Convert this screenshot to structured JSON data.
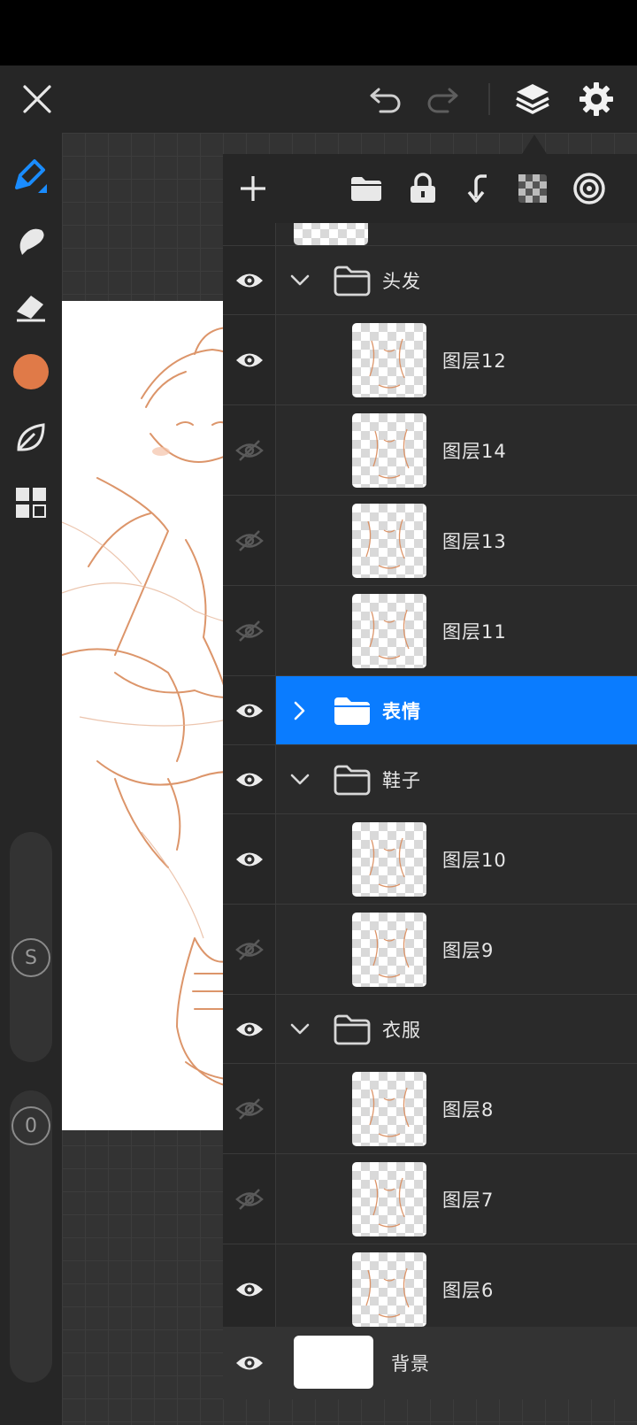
{
  "colors": {
    "accent": "#0a7cff",
    "brush_color": "#e07a48",
    "panel_bg": "#262626"
  },
  "top_bar": {
    "close": {
      "icon": "close-icon"
    },
    "undo": {
      "icon": "undo-icon"
    },
    "redo": {
      "icon": "redo-icon"
    },
    "layers": {
      "icon": "layers-icon"
    },
    "settings": {
      "icon": "gear-icon"
    }
  },
  "left_toolbar": {
    "tools": [
      {
        "name": "brush",
        "icon": "brush-icon",
        "active": true
      },
      {
        "name": "smudge",
        "icon": "smudge-icon",
        "active": false
      },
      {
        "name": "eraser",
        "icon": "eraser-icon",
        "active": false
      },
      {
        "name": "color",
        "icon": "color-swatch-icon",
        "active": false
      },
      {
        "name": "brush-library",
        "icon": "leaf-icon",
        "active": false
      },
      {
        "name": "gallery",
        "icon": "grid-icon",
        "active": false
      }
    ],
    "size_slider": {
      "label": "S"
    },
    "opacity_slider": {
      "label": "0"
    }
  },
  "layers_panel": {
    "toolbar": [
      {
        "icon": "plus-icon"
      },
      {
        "icon": "folder-icon"
      },
      {
        "icon": "lock-icon"
      },
      {
        "icon": "merge-down-icon"
      },
      {
        "icon": "alpha-lock-icon"
      },
      {
        "icon": "blend-mode-icon"
      }
    ],
    "rows": [
      {
        "type": "folder",
        "label": "头发",
        "visible": true,
        "expanded": true
      },
      {
        "type": "layer",
        "label": "图层12",
        "visible": true
      },
      {
        "type": "layer",
        "label": "图层14",
        "visible": false
      },
      {
        "type": "layer",
        "label": "图层13",
        "visible": false
      },
      {
        "type": "layer",
        "label": "图层11",
        "visible": false
      },
      {
        "type": "folder",
        "label": "表情",
        "visible": true,
        "expanded": false,
        "selected": true
      },
      {
        "type": "folder",
        "label": "鞋子",
        "visible": true,
        "expanded": true
      },
      {
        "type": "layer",
        "label": "图层10",
        "visible": true
      },
      {
        "type": "layer",
        "label": "图层9",
        "visible": false
      },
      {
        "type": "folder",
        "label": "衣服",
        "visible": true,
        "expanded": true
      },
      {
        "type": "layer",
        "label": "图层8",
        "visible": false
      },
      {
        "type": "layer",
        "label": "图层7",
        "visible": false
      },
      {
        "type": "layer",
        "label": "图层6",
        "visible": true
      }
    ],
    "background": {
      "label": "背景",
      "visible": true
    }
  }
}
